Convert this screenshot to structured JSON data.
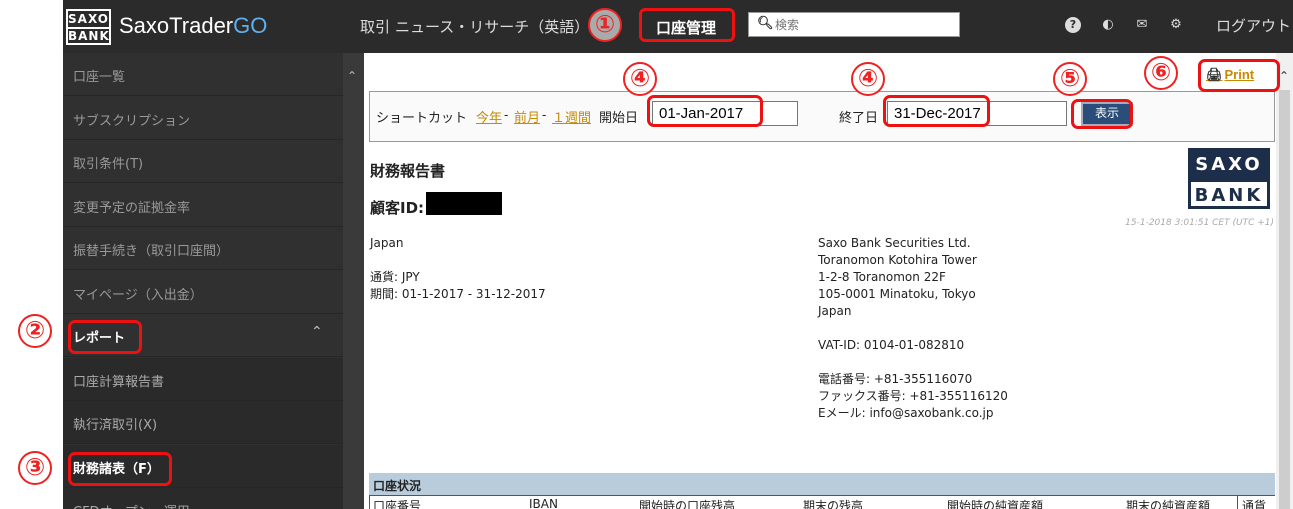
{
  "app": {
    "logo_top": "SAXO",
    "logo_bottom": "BANK",
    "name": "SaxoTrader",
    "name_suffix": "GO"
  },
  "topnav": {
    "trade": "取引",
    "news": "ニュース・リサーチ（英語）",
    "account": "口座管理",
    "search_icon": "search-icon",
    "search_placeholder": "検索",
    "icons": [
      "help-icon",
      "theme-icon",
      "mail-icon",
      "gear-icon"
    ],
    "help_glyph": "?",
    "logout": "ログアウト"
  },
  "sidebar": {
    "items": [
      {
        "label": "口座一覧"
      },
      {
        "label": "サブスクリプション"
      },
      {
        "label": "取引条件(T)"
      },
      {
        "label": "変更予定の証拠金率"
      },
      {
        "label": "振替手続き（取引口座間）"
      },
      {
        "label": "マイページ（入出金）"
      }
    ],
    "report": "レポート",
    "sub_items": [
      {
        "label": "口座計算報告書"
      },
      {
        "label": "執行済取引(X)"
      },
      {
        "label": "財務諸表（F）"
      },
      {
        "label": "CFDオープン・運用"
      }
    ]
  },
  "filter": {
    "shortcut_label": "ショートカット",
    "this_year": "今年",
    "last_month": "前月",
    "one_week": "１週間",
    "sep": "-",
    "start_label": "開始日",
    "start_value": "01-Jan-2017",
    "end_label": "終了日",
    "end_value": "31-Dec-2017",
    "show_button": "表示",
    "print": "Print"
  },
  "report": {
    "title": "財務報告書",
    "client_id_label": "顧客ID:",
    "logo_top": "SAXO",
    "logo_bottom": "BANK",
    "timestamp": "15-1-2018 3:01:51 CET (UTC +1)",
    "client_country": "Japan",
    "currency": "通貨: JPY",
    "period": "期間: 01-1-2017 - 31-12-2017",
    "bank_lines": [
      "Saxo Bank Securities Ltd.",
      "Toranomon Kotohira Tower",
      "1-2-8 Toranomon 22F",
      "105-0001 Minatoku, Tokyo",
      "Japan"
    ],
    "vat": "VAT-ID: 0104-01-082810",
    "phone": "電話番号: +81-355116070",
    "fax": "ファックス番号: +81-355116120",
    "email": "Eメール: info@saxobank.co.jp"
  },
  "account_status": {
    "header": "口座状況",
    "columns": [
      "口座番号",
      "IBAN",
      "開始時の口座残高",
      "期末の残高",
      "開始時の純資産額",
      "期末の純資産額",
      "通貨"
    ]
  },
  "annotations": [
    "①",
    "②",
    "③",
    "④",
    "④",
    "⑤",
    "⑥"
  ]
}
